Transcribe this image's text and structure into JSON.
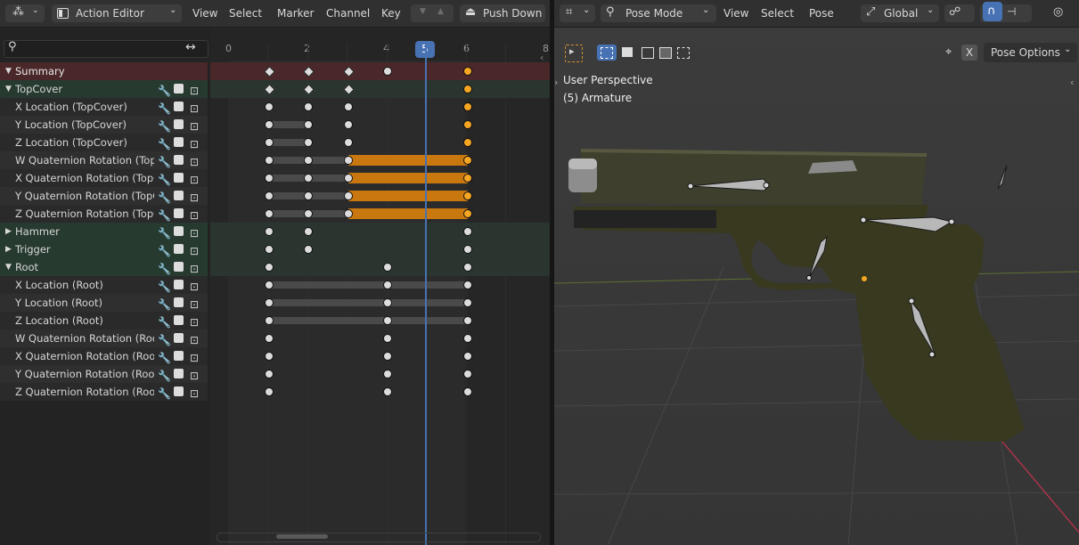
{
  "dopesheet": {
    "editor_type": "Action Editor",
    "menus": [
      "View",
      "Select",
      "Marker",
      "Channel",
      "Key"
    ],
    "push_down": "Push Down",
    "frame_ruler": [
      "0",
      "2",
      "4",
      "6",
      "8"
    ],
    "current_frame": "5",
    "channels": [
      {
        "label": "Summary",
        "type": "summary"
      },
      {
        "label": "TopCover",
        "type": "group",
        "expanded": true
      },
      {
        "label": "X Location (TopCover)",
        "type": "channel"
      },
      {
        "label": "Y Location (TopCover)",
        "type": "channel"
      },
      {
        "label": "Z Location (TopCover)",
        "type": "channel"
      },
      {
        "label": "W Quaternion Rotation (Top",
        "type": "channel"
      },
      {
        "label": "X Quaternion Rotation (TopC",
        "type": "channel"
      },
      {
        "label": "Y Quaternion Rotation (TopC",
        "type": "channel"
      },
      {
        "label": "Z Quaternion Rotation (TopC",
        "type": "channel"
      },
      {
        "label": "Hammer",
        "type": "group",
        "expanded": false
      },
      {
        "label": "Trigger",
        "type": "group",
        "expanded": false
      },
      {
        "label": "Root",
        "type": "group",
        "expanded": true
      },
      {
        "label": "X Location (Root)",
        "type": "channel"
      },
      {
        "label": "Y Location (Root)",
        "type": "channel"
      },
      {
        "label": "Z Location (Root)",
        "type": "channel"
      },
      {
        "label": "W Quaternion Rotation (Roo",
        "type": "channel"
      },
      {
        "label": "X Quaternion Rotation (Root",
        "type": "channel"
      },
      {
        "label": "Y Quaternion Rotation (Root",
        "type": "channel"
      },
      {
        "label": "Z Quaternion Rotation (Root",
        "type": "channel"
      }
    ]
  },
  "viewport": {
    "mode": "Pose Mode",
    "menus": [
      "View",
      "Select",
      "Pose"
    ],
    "orientation": "Global",
    "pose_options": "Pose Options",
    "x_toggle": "X",
    "overlay_title": "User Perspective",
    "overlay_object": "(5) Armature"
  },
  "colors": {
    "accent": "#4772b3",
    "selected_key": "#f5a623",
    "held_bar": "#c9780f"
  }
}
